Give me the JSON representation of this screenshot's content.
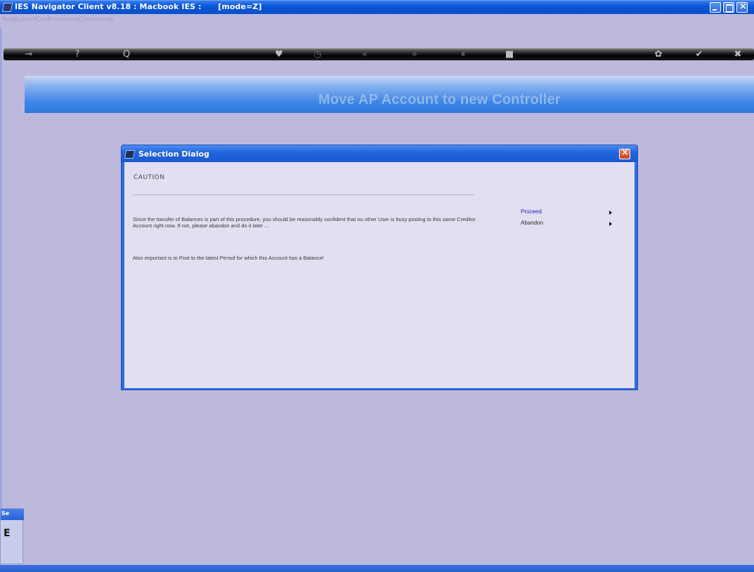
{
  "window": {
    "title": "IES Navigator Client v8.18 : Macbook IES :      [mode=Z]"
  },
  "menu": [
    {
      "label": "Help"
    },
    {
      "label": "Submit"
    },
    {
      "label": "Quit"
    },
    {
      "label": "Functions"
    },
    {
      "label": "Commands"
    }
  ],
  "toolbar": {
    "icons": [
      "key-icon",
      "help-icon",
      "search-icon",
      "heart-icon",
      "clock-icon",
      "rewind-icon",
      "forward-icon",
      "pause-icon",
      "stop-icon",
      "gear-icon",
      "check-icon",
      "close-icon"
    ],
    "glyphs": {
      "key": "⊸",
      "help": "?",
      "search": "Q",
      "heart": "♥",
      "clock": "◷",
      "rewind": "«",
      "forward": "»",
      "pause": "⏸",
      "stop": "■",
      "gear": "✿",
      "check": "✔",
      "close": "✖"
    }
  },
  "banner": {
    "heading": "Move AP Account to new Controller"
  },
  "dialog": {
    "title": "Selection Dialog",
    "caution": "CAUTION",
    "paragraph1": "Since the transfer of Balances is part of this procedure, you should be reasonably confident that no other User is busy posting to this same Creditor Account right now. If not, please abandon and do it later ...",
    "paragraph2": "Also important is to Post to the latest Period for which this Account has a Balance!",
    "options": [
      {
        "label": "Proceed"
      },
      {
        "label": "Abandon"
      }
    ]
  },
  "side_panel": {
    "title": "Se",
    "value": "E"
  }
}
